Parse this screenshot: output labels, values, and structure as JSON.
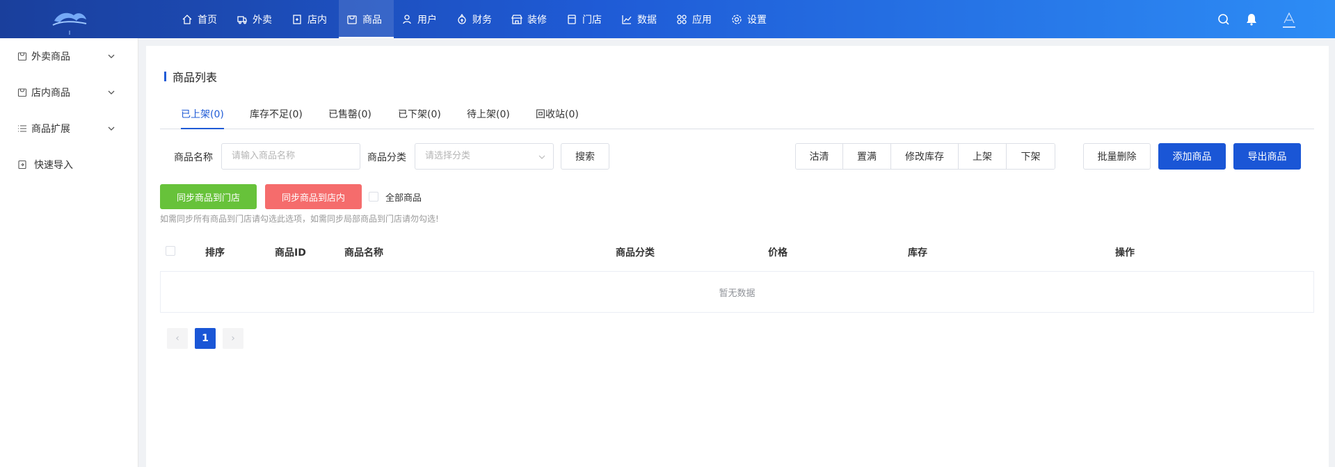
{
  "colors": {
    "primary": "#1a56d6",
    "green": "#67c23a",
    "red": "#f56c6c",
    "topbar_start": "#1a3f9c",
    "topbar_end": "#2d8cf5"
  },
  "topnav": {
    "items": [
      {
        "label": "首页",
        "icon": "home-icon"
      },
      {
        "label": "外卖",
        "icon": "delivery-icon"
      },
      {
        "label": "店内",
        "icon": "store-in-icon"
      },
      {
        "label": "商品",
        "icon": "goods-icon",
        "active": true
      },
      {
        "label": "用户",
        "icon": "user-icon"
      },
      {
        "label": "财务",
        "icon": "finance-icon"
      },
      {
        "label": "装修",
        "icon": "decor-icon"
      },
      {
        "label": "门店",
        "icon": "shop-icon"
      },
      {
        "label": "数据",
        "icon": "chart-icon"
      },
      {
        "label": "应用",
        "icon": "apps-icon"
      },
      {
        "label": "设置",
        "icon": "settings-icon"
      }
    ],
    "right_icons": [
      "search-icon",
      "bell-icon",
      "avatar"
    ]
  },
  "sidebar": {
    "items": [
      {
        "label": "外卖商品",
        "icon": "bag-icon",
        "expandable": true
      },
      {
        "label": "店内商品",
        "icon": "bag-icon",
        "expandable": true
      },
      {
        "label": "商品扩展",
        "icon": "list-icon",
        "expandable": true
      },
      {
        "label": "快速导入",
        "icon": "import-icon",
        "expandable": false
      }
    ]
  },
  "page": {
    "title": "商品列表",
    "tabs": [
      "已上架(0)",
      "库存不足(0)",
      "已售罄(0)",
      "已下架(0)",
      "待上架(0)",
      "回收站(0)"
    ],
    "active_tab": 0
  },
  "filters": {
    "name_label": "商品名称",
    "name_placeholder": "请输入商品名称",
    "category_label": "商品分类",
    "category_placeholder": "请选择分类",
    "search_button": "搜索"
  },
  "actions": {
    "group": [
      "沽清",
      "置满",
      "修改库存",
      "上架",
      "下架"
    ],
    "batch_delete": "批量删除",
    "add": "添加商品",
    "export": "导出商品"
  },
  "sync": {
    "to_store": "同步商品到门店",
    "to_inside": "同步商品到店内",
    "all_label": "全部商品",
    "hint": "如需同步所有商品到门店请勾选此选项，如需同步局部商品到门店请勿勾选!"
  },
  "table": {
    "columns": [
      "排序",
      "商品ID",
      "商品名称",
      "商品分类",
      "价格",
      "库存",
      "操作"
    ],
    "empty_text": "暂无数据"
  },
  "pagination": {
    "current": "1",
    "prev": "‹",
    "next": "›"
  }
}
